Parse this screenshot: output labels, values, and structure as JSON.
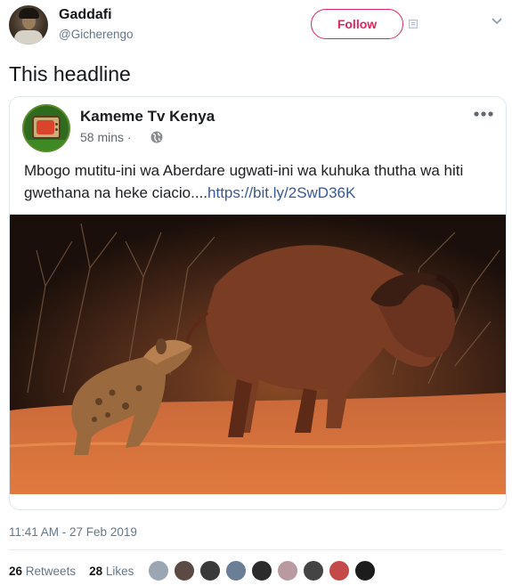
{
  "author": {
    "display_name": "Gaddafi",
    "handle": "@Gicherengo"
  },
  "header": {
    "follow_label": "Follow",
    "menu_icon": "chevron-down-icon"
  },
  "tweet": {
    "text": "This headline",
    "timestamp": "11:41 AM - 27 Feb 2019"
  },
  "embed": {
    "page_name": "Kameme Tv Kenya",
    "time": "58 mins",
    "separator": "·",
    "post_text": "Mbogo mutitu-ini wa Aberdare ugwati-ini wa kuhuka thutha wa hiti gwethana na heke ciacio....",
    "post_link": "https://bit.ly/2SwD36K",
    "more_icon": "more-horizontal-icon",
    "privacy_icon": "globe-icon"
  },
  "stats": {
    "retweets_count": "26",
    "retweets_label": "Retweets",
    "likes_count": "28",
    "likes_label": "Likes"
  },
  "colors": {
    "follow": "#e0245e",
    "link": "#385898",
    "muted": "#657786"
  },
  "likers": [
    "#9aa7b3",
    "#5a4a43",
    "#3a3a3a",
    "#6a7f95",
    "#2b2b2b",
    "#b89aa0",
    "#444444",
    "#c44a4a",
    "#1c1c1c"
  ]
}
